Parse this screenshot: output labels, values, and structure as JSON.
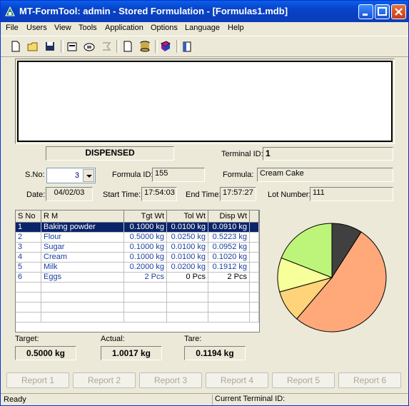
{
  "window": {
    "title": "MT-FormTool: admin - Stored Formulation - [Formulas1.mdb]"
  },
  "menu": [
    "File",
    "Users",
    "View",
    "Tools",
    "Application",
    "Options",
    "Language",
    "Help"
  ],
  "toolbar": [
    "new-file-icon",
    "open-folder-icon",
    "save-icon",
    "properties-icon",
    "phone-icon",
    "transfer-icon",
    "page-icon",
    "database-icon",
    "book-icon",
    "report-icon"
  ],
  "status_box": "DISPENSED",
  "terminal": {
    "label": "Terminal ID:",
    "value": "1"
  },
  "sno": {
    "label": "S.No:",
    "value": "3"
  },
  "formula_id": {
    "label": "Formula ID:",
    "value": "155"
  },
  "formula": {
    "label": "Formula:",
    "value": "Cream Cake"
  },
  "date": {
    "label": "Date:",
    "value": "04/02/03"
  },
  "start_time": {
    "label": "Start Time:",
    "value": "17:54:03"
  },
  "end_time": {
    "label": "End Time:",
    "value": "17:57:27"
  },
  "lot": {
    "label": "Lot Number:",
    "value": "111"
  },
  "table": {
    "headers": [
      "S No",
      "R M",
      "Tgt Wt",
      "Tol Wt",
      "Disp Wt"
    ],
    "rows": [
      [
        "1",
        "Baking powder",
        "0.1000 kg",
        "0.0100 kg",
        "0.0910 kg"
      ],
      [
        "2",
        "Flour",
        "0.5000 kg",
        "0.0250 kg",
        "0.5223 kg"
      ],
      [
        "3",
        "Sugar",
        "0.1000 kg",
        "0.0100 kg",
        "0.0952 kg"
      ],
      [
        "4",
        "Cream",
        "0.1000 kg",
        "0.0100 kg",
        "0.1020 kg"
      ],
      [
        "5",
        "Milk",
        "0.2000 kg",
        "0.0200 kg",
        "0.1912 kg"
      ],
      [
        "6",
        "Eggs",
        "2 Pcs",
        "0 Pcs",
        "2 Pcs"
      ]
    ]
  },
  "totals": {
    "target_label": "Target:",
    "target": "0.5000 kg",
    "actual_label": "Actual:",
    "actual": "1.0017 kg",
    "tare_label": "Tare:",
    "tare": "0.1194 kg"
  },
  "reports": [
    "Report 1",
    "Report 2",
    "Report 3",
    "Report 4",
    "Report 5",
    "Report 6"
  ],
  "statusbar": {
    "left": "Ready",
    "right": "Current Terminal ID:"
  },
  "pie": {
    "slices": [
      {
        "value": 0.091,
        "color": "#404040"
      },
      {
        "value": 0.5223,
        "color": "#ffa97a"
      },
      {
        "value": 0.0952,
        "color": "#ffd37a"
      },
      {
        "value": 0.102,
        "color": "#f6ff9a"
      },
      {
        "value": 0.1912,
        "color": "#bdf57a"
      }
    ]
  }
}
